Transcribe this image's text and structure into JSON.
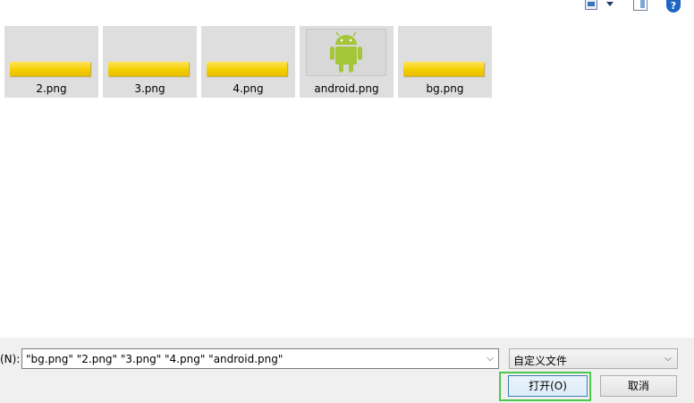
{
  "toolbar": {
    "view_icon": "view-menu-icon",
    "dropdown_icon": "chevron-down-icon",
    "pane_icon": "preview-pane-icon",
    "help_icon": "help-icon",
    "help_glyph": "?"
  },
  "files": [
    {
      "name": "2.png",
      "thumb": "yellow-bar"
    },
    {
      "name": "3.png",
      "thumb": "yellow-bar"
    },
    {
      "name": "4.png",
      "thumb": "yellow-bar"
    },
    {
      "name": "android.png",
      "thumb": "android"
    },
    {
      "name": "bg.png",
      "thumb": "yellow-bar"
    }
  ],
  "colors": {
    "android_green": "#a4c639",
    "thumb_yellow": "#f5cf00",
    "focus_green": "#4cc94c"
  },
  "bottom": {
    "filename_label": "(N):",
    "filename_value": "\"bg.png\" \"2.png\" \"3.png\" \"4.png\" \"android.png\"",
    "filetype_value": "自定义文件",
    "dropdown_glyph": "⌵",
    "open_label": "打开(O)",
    "cancel_label": "取消"
  }
}
